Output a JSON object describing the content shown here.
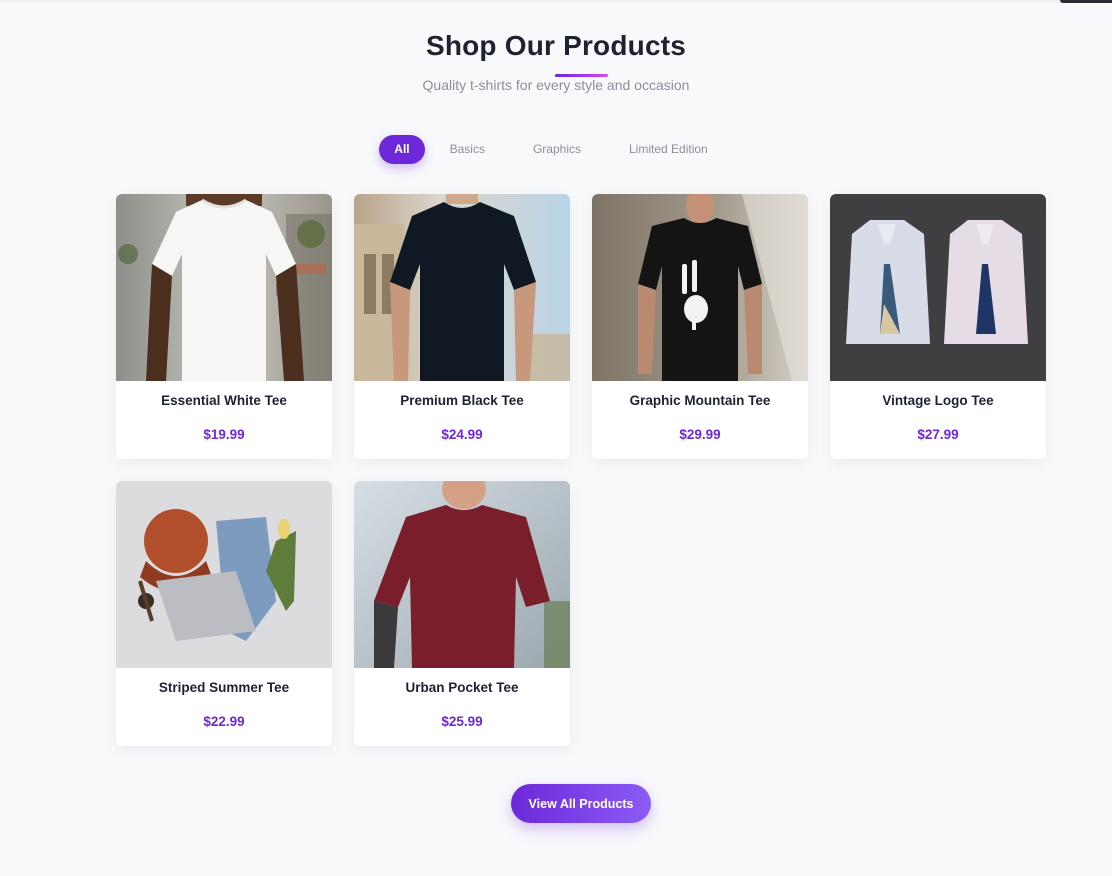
{
  "header": {
    "title": "Shop Our Products",
    "subtitle": "Quality t-shirts for every style and occasion"
  },
  "filters": [
    {
      "label": "All",
      "active": true
    },
    {
      "label": "Basics",
      "active": false
    },
    {
      "label": "Graphics",
      "active": false
    },
    {
      "label": "Limited Edition",
      "active": false
    }
  ],
  "products": [
    {
      "name": "Essential White Tee",
      "price": "$19.99"
    },
    {
      "name": "Premium Black Tee",
      "price": "$24.99"
    },
    {
      "name": "Graphic Mountain Tee",
      "price": "$29.99"
    },
    {
      "name": "Vintage Logo Tee",
      "price": "$27.99"
    },
    {
      "name": "Striped Summer Tee",
      "price": "$22.99"
    },
    {
      "name": "Urban Pocket Tee",
      "price": "$25.99"
    }
  ],
  "cta": {
    "label": "View All Products"
  },
  "colors": {
    "accent": "#6d28d9",
    "accent_light": "#8b5cf6",
    "background": "#f8f9fb"
  }
}
